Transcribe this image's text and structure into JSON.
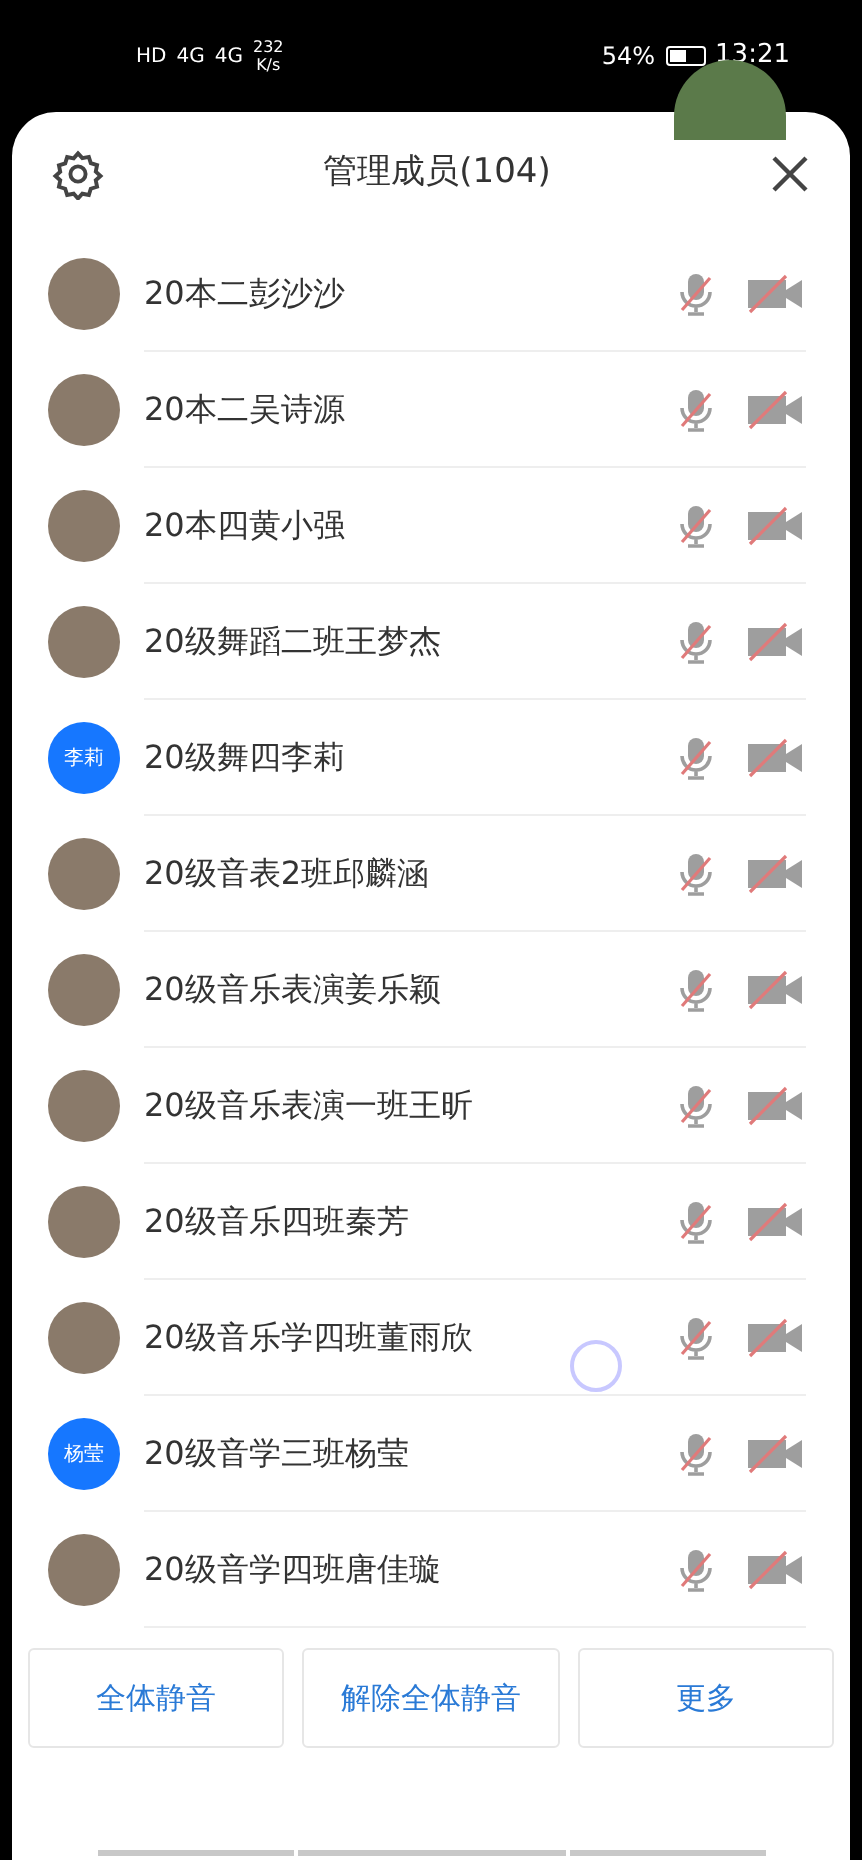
{
  "status_bar": {
    "network_left": [
      "HD",
      "4G",
      "4G"
    ],
    "speed": "232",
    "speed_unit": "K/s",
    "battery": "54%",
    "time": "13:21"
  },
  "header": {
    "title": "管理成员(104)"
  },
  "members": [
    {
      "name": "20本二彭沙沙",
      "kind": "photo",
      "mic_muted": true,
      "camera_off": true
    },
    {
      "name": "20本二吴诗源",
      "kind": "photo",
      "mic_muted": true,
      "camera_off": true
    },
    {
      "name": "20本四黄小强",
      "kind": "photo",
      "mic_muted": true,
      "camera_off": true
    },
    {
      "name": "20级舞蹈二班王梦杰",
      "kind": "photo",
      "mic_muted": true,
      "camera_off": true
    },
    {
      "name": "20级舞四李莉",
      "kind": "text",
      "avatar_text": "李莉",
      "mic_muted": true,
      "camera_off": true
    },
    {
      "name": "20级音表2班邱麟涵",
      "kind": "photo",
      "mic_muted": true,
      "camera_off": true
    },
    {
      "name": "20级音乐表演姜乐颖",
      "kind": "photo",
      "mic_muted": true,
      "camera_off": true
    },
    {
      "name": "20级音乐表演一班王昕",
      "kind": "photo",
      "mic_muted": true,
      "camera_off": true
    },
    {
      "name": "20级音乐四班秦芳",
      "kind": "photo",
      "mic_muted": true,
      "camera_off": true
    },
    {
      "name": "20级音乐学四班董雨欣",
      "kind": "photo",
      "mic_muted": true,
      "camera_off": true
    },
    {
      "name": "20级音学三班杨莹",
      "kind": "text",
      "avatar_text": "杨莹",
      "mic_muted": true,
      "camera_off": true
    },
    {
      "name": "20级音学四班唐佳璇",
      "kind": "photo",
      "mic_muted": true,
      "camera_off": true
    }
  ],
  "buttons": [
    "全体静音",
    "解除全体静音",
    "更多"
  ]
}
